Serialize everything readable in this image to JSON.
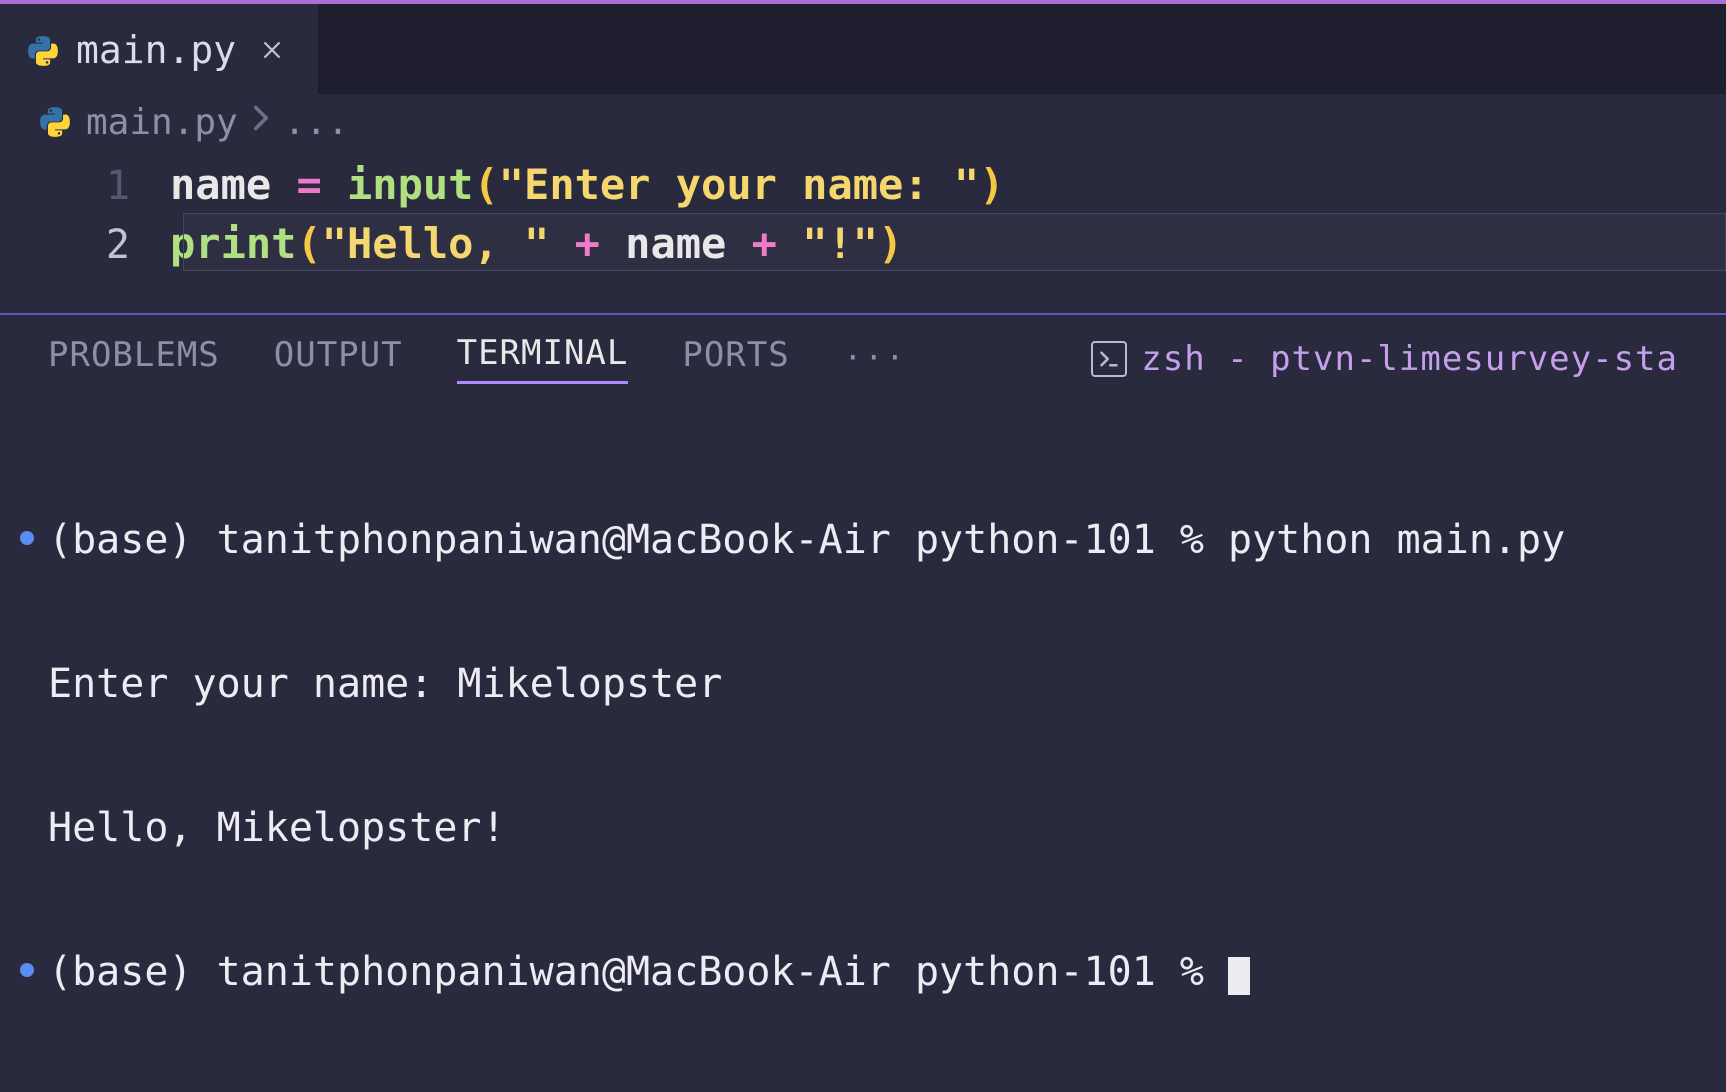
{
  "tab": {
    "filename": "main.py"
  },
  "breadcrumb": {
    "filename": "main.py",
    "ellipsis": "..."
  },
  "editor": {
    "lines": [
      {
        "num": "1"
      },
      {
        "num": "2"
      }
    ],
    "l1": {
      "a_ident": "name",
      "b_op": " = ",
      "c_func": "input",
      "d_paren_l": "(",
      "e_str": "\"Enter your name: \"",
      "f_paren_r": ")"
    },
    "l2": {
      "a_func": "print",
      "b_paren_l": "(",
      "c_str1": "\"Hello, \"",
      "d_plus1": " + ",
      "e_ident": "name",
      "f_plus2": " + ",
      "g_str2": "\"!\"",
      "h_paren_r": ")"
    }
  },
  "panel": {
    "tabs": {
      "problems": "PROBLEMS",
      "output": "OUTPUT",
      "terminal": "TERMINAL",
      "ports": "PORTS"
    },
    "ellipsis": "···",
    "shell_label": "zsh - ptvn-limesurvey-sta"
  },
  "terminal": {
    "line1": "(base) tanitphonpaniwan@MacBook-Air python-101 % python main.py",
    "line2": "Enter your name: Mikelopster",
    "line3": "Hello, Mikelopster!",
    "line4_prefix": "(base) tanitphonpaniwan@MacBook-Air python-101 % "
  }
}
